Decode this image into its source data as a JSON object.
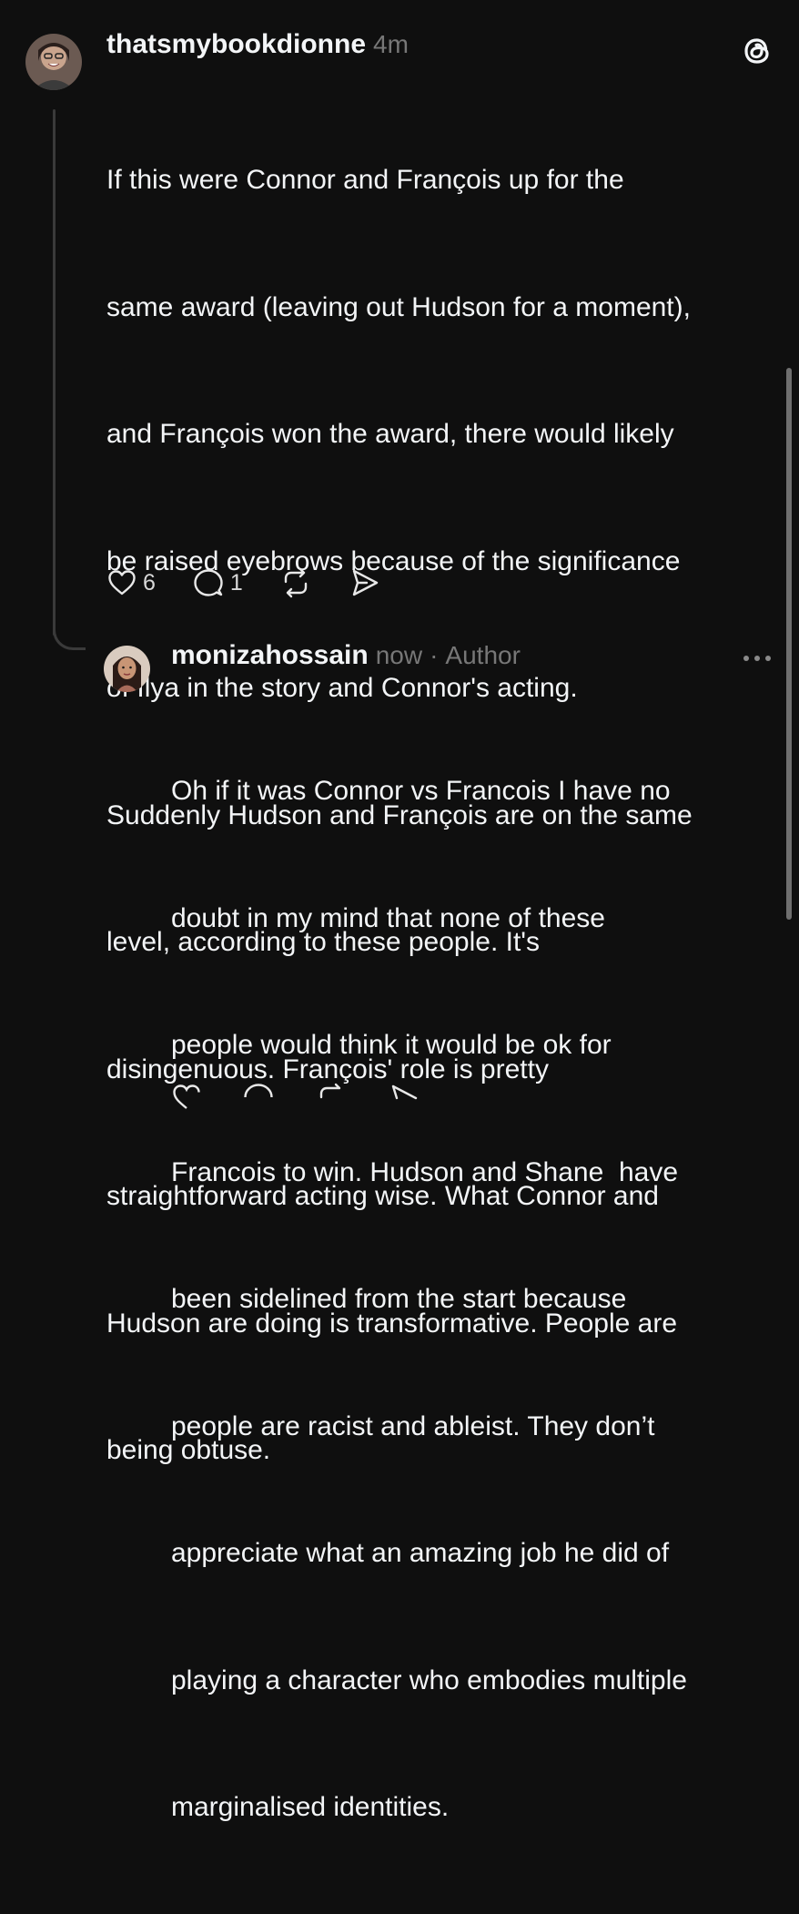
{
  "post": {
    "username": "thatsmybookdionne",
    "time": "4m",
    "lines": [
      "If this were Connor and François up for the",
      "same award (leaving out Hudson for a moment),",
      "and François won the award, there would likely",
      "be raised eyebrows because of the significance",
      "of Ilya in the story and Connor's acting.",
      "Suddenly Hudson and François are on the same",
      "level, according to these people. It's",
      "disingenuous. François' role is pretty",
      "straightforward acting wise. What Connor and",
      "Hudson are doing is transformative. People are",
      "being obtuse."
    ],
    "like_count": "6",
    "reply_count": "1"
  },
  "reply": {
    "username": "monizahossain",
    "time": "now",
    "separator": "·",
    "author_label": "Author",
    "lines": [
      "Oh if it was Connor vs Francois I have no",
      "doubt in my mind that none of these",
      "people would think it would be ok for",
      "Francois to win. Hudson and Shane  have",
      "been sidelined from the start because",
      "people are racist and ableist. They don’t",
      "appreciate what an amazing job he did of",
      "playing a character who embodies multiple",
      "marginalised identities."
    ]
  },
  "icons": {
    "like": "heart-icon",
    "comment": "comment-bubble-icon",
    "repost": "repost-icon",
    "share": "send-icon",
    "logo": "threads-logo-icon",
    "more": "more-dots-icon"
  },
  "colors": {
    "background": "#0f0f0f",
    "text": "#f3f5f7",
    "muted": "#777777",
    "thread_line": "#3a3a3a"
  }
}
